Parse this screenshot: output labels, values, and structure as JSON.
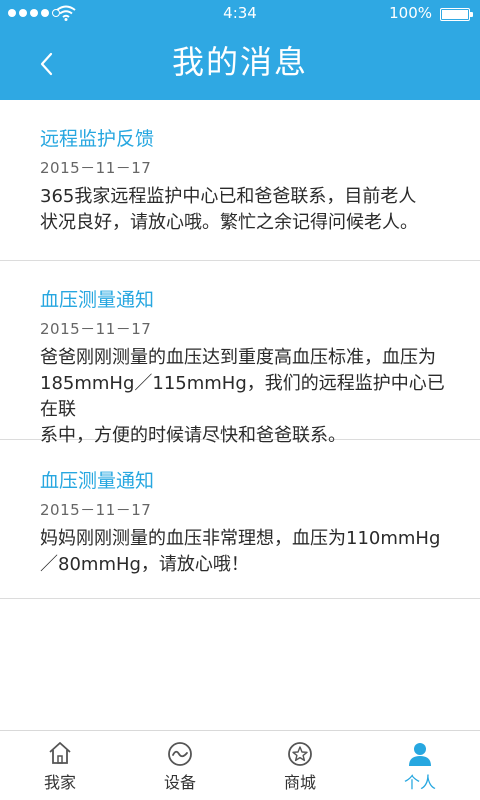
{
  "status_bar": {
    "time": "4:34",
    "battery": "100%"
  },
  "nav": {
    "title": "我的消息"
  },
  "messages": [
    {
      "title": "远程监护反馈",
      "date": "2015－11－17",
      "lines": [
        "365我家远程监护中心已和爸爸联系，目前老人",
        "状况良好，请放心哦。繁忙之余记得问候老人。"
      ]
    },
    {
      "title": "血压测量通知",
      "date": "2015－11－17",
      "lines": [
        "爸爸刚刚测量的血压达到重度高血压标准，血压为",
        "185mmHg／115mmHg，我们的远程监护中心已在联",
        "系中，方便的时候请尽快和爸爸联系。"
      ]
    },
    {
      "title": "血压测量通知",
      "date": "2015－11－17",
      "lines": [
        "妈妈刚刚测量的血压非常理想，血压为110mmHg",
        "／80mmHg，请放心哦！"
      ]
    }
  ],
  "tabs": [
    {
      "label": "我家",
      "icon": "home-icon",
      "active": false
    },
    {
      "label": "设备",
      "icon": "device-icon",
      "active": false
    },
    {
      "label": "商城",
      "icon": "store-icon",
      "active": false
    },
    {
      "label": "个人",
      "icon": "person-icon",
      "active": true
    }
  ],
  "colors": {
    "primary": "#2fa8e3",
    "accent_text": "#27a7e0",
    "divider": "#dcdcdc"
  }
}
